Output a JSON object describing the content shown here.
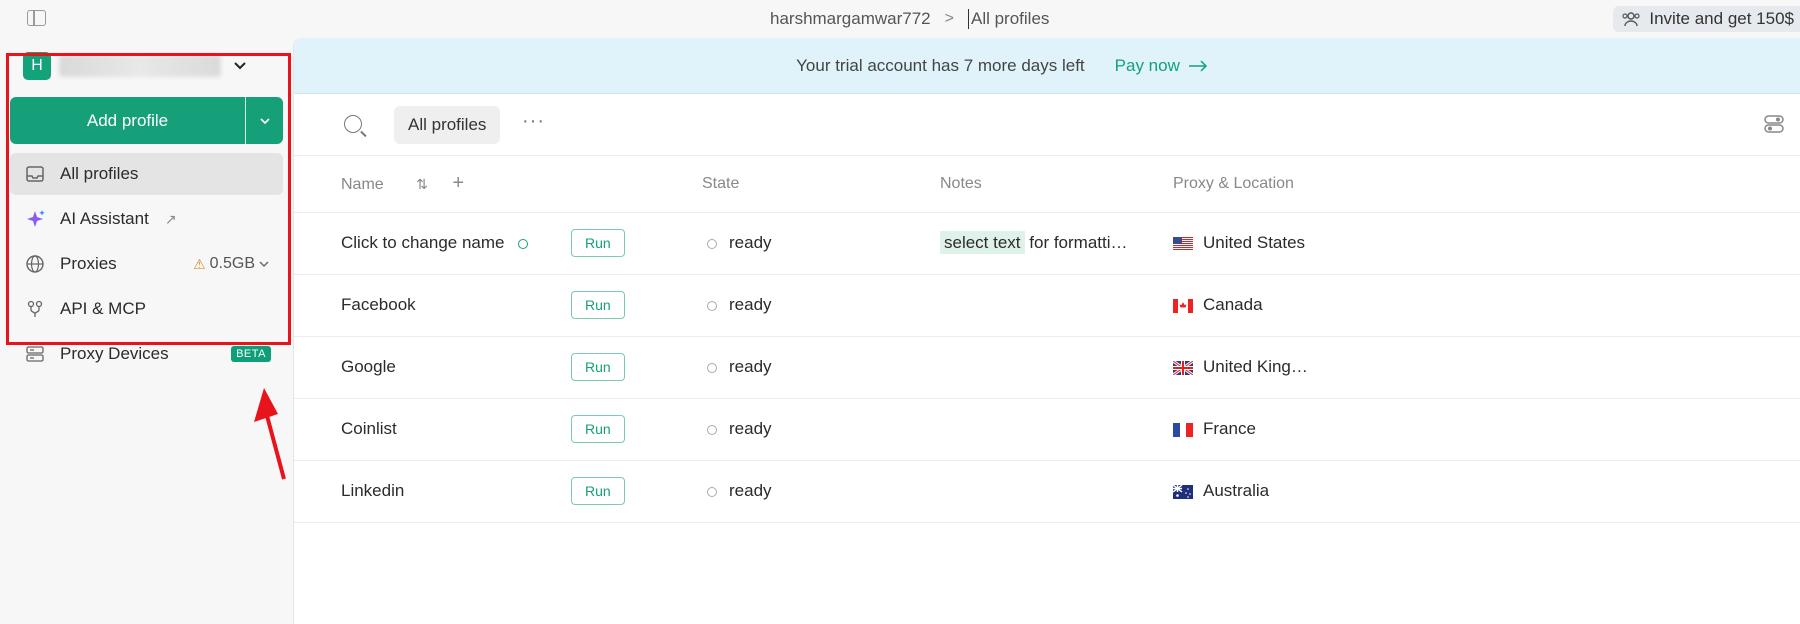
{
  "topbar": {
    "breadcrumb_user": "harshmargamwar772",
    "breadcrumb_sep": ">",
    "breadcrumb_current": "All profiles",
    "invite_label": "Invite and get 150$"
  },
  "workspace": {
    "avatar_letter": "H"
  },
  "sidebar": {
    "add_profile_label": "Add profile",
    "items": [
      {
        "label": "All profiles",
        "icon": "inbox-icon"
      },
      {
        "label": "AI Assistant",
        "icon": "sparkle-icon"
      },
      {
        "label": "Proxies",
        "icon": "globe-icon",
        "quota": "0.5GB"
      },
      {
        "label": "API & MCP",
        "icon": "api-icon"
      },
      {
        "label": "Proxy Devices",
        "icon": "server-icon",
        "badge": "BETA"
      }
    ]
  },
  "banner": {
    "message": "Your trial account has 7 more days left",
    "action": "Pay now"
  },
  "toolbar": {
    "chip_label": "All profiles"
  },
  "table": {
    "headers": {
      "name": "Name",
      "state": "State",
      "notes": "Notes",
      "proxy": "Proxy & Location"
    },
    "rows": [
      {
        "name": "Click to change name",
        "run": "Run",
        "state": "ready",
        "note_highlight": "select text",
        "note_rest": " for formatti…",
        "location": "United States",
        "flag": "us"
      },
      {
        "name": "Facebook",
        "run": "Run",
        "state": "ready",
        "note_highlight": "",
        "note_rest": "",
        "location": "Canada",
        "flag": "ca"
      },
      {
        "name": "Google",
        "run": "Run",
        "state": "ready",
        "note_highlight": "",
        "note_rest": "",
        "location": "United King…",
        "flag": "gb"
      },
      {
        "name": "Coinlist",
        "run": "Run",
        "state": "ready",
        "note_highlight": "",
        "note_rest": "",
        "location": "France",
        "flag": "fr"
      },
      {
        "name": "Linkedin",
        "run": "Run",
        "state": "ready",
        "note_highlight": "",
        "note_rest": "",
        "location": "Australia",
        "flag": "au"
      }
    ]
  },
  "colors": {
    "accent": "#16a07a",
    "highlight_box": "#e8141b",
    "banner_bg": "#e0f3fb"
  }
}
